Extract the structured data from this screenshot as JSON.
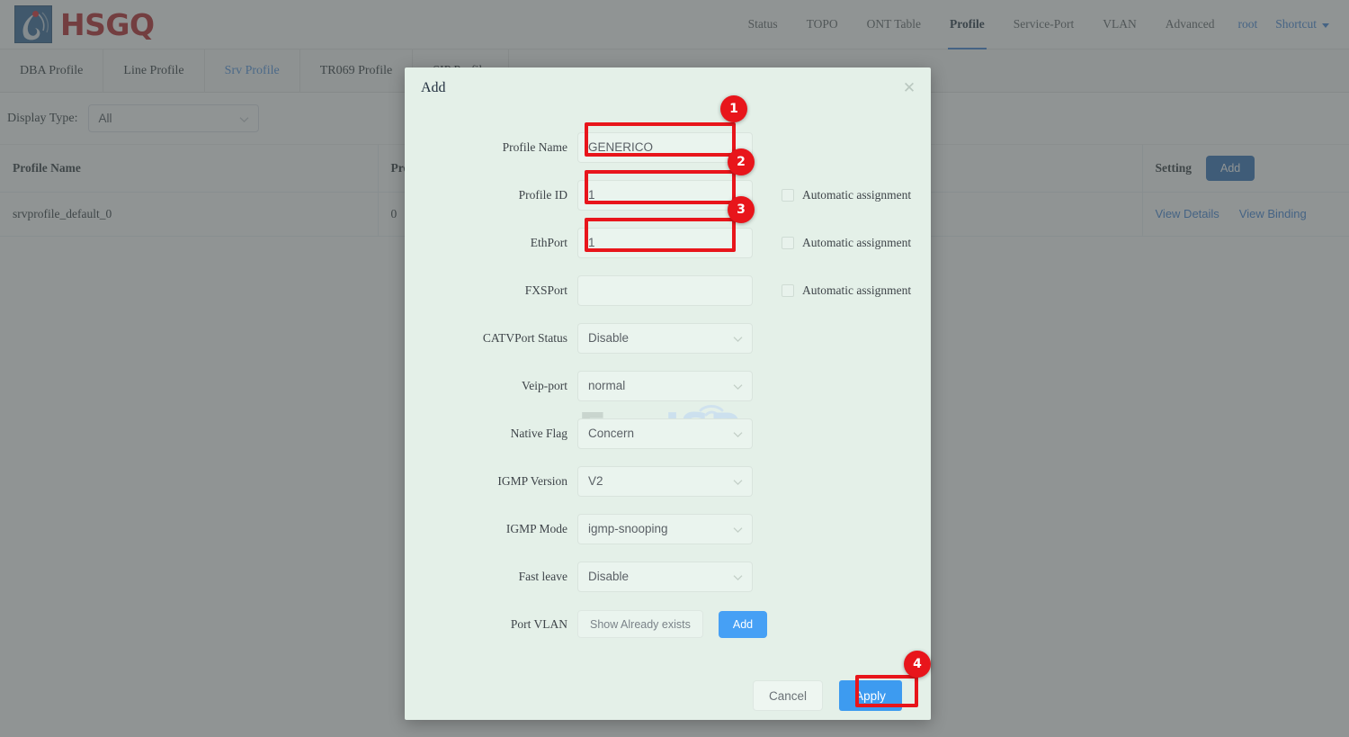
{
  "header": {
    "brand_name": "HSGQ",
    "logo_icon": "hsgq-droplet-logo",
    "nav": [
      {
        "label": "Status",
        "active": false
      },
      {
        "label": "TOPO",
        "active": false
      },
      {
        "label": "ONT Table",
        "active": false
      },
      {
        "label": "Profile",
        "active": true
      },
      {
        "label": "Service-Port",
        "active": false
      },
      {
        "label": "VLAN",
        "active": false
      },
      {
        "label": "Advanced",
        "active": false
      }
    ],
    "user_label": "root",
    "shortcut_label": "Shortcut"
  },
  "subtabs": [
    {
      "label": "DBA Profile",
      "active": false
    },
    {
      "label": "Line Profile",
      "active": false
    },
    {
      "label": "Srv Profile",
      "active": true
    },
    {
      "label": "TR069 Profile",
      "active": false
    },
    {
      "label": "SIP Profile",
      "active": false
    }
  ],
  "filter": {
    "label": "Display Type:",
    "value": "All"
  },
  "table": {
    "columns": [
      "Profile Name",
      "Profile ID",
      "Setting"
    ],
    "add_button": "Add",
    "rows": [
      {
        "profile_name": "srvprofile_default_0",
        "profile_id": "0",
        "actions": [
          "View Details",
          "View Binding"
        ]
      }
    ]
  },
  "modal": {
    "title": "Add",
    "close_icon": "close-icon",
    "watermark": "ForoISP",
    "watermark_part1": "Foro",
    "watermark_part2": "ISP",
    "fields": {
      "profile_name": {
        "label": "Profile Name",
        "value": "GENERICO"
      },
      "profile_id": {
        "label": "Profile ID",
        "value": "1",
        "checkbox_label": "Automatic assignment",
        "checked": false
      },
      "eth_port": {
        "label": "EthPort",
        "value": "1",
        "checkbox_label": "Automatic assignment",
        "checked": false
      },
      "fxs_port": {
        "label": "FXSPort",
        "value": "",
        "checkbox_label": "Automatic assignment",
        "checked": false
      },
      "catv_port_status": {
        "label": "CATVPort Status",
        "value": "Disable"
      },
      "veip_port": {
        "label": "Veip-port",
        "value": "normal"
      },
      "native_flag": {
        "label": "Native Flag",
        "value": "Concern"
      },
      "igmp_version": {
        "label": "IGMP Version",
        "value": "V2"
      },
      "igmp_mode": {
        "label": "IGMP Mode",
        "value": "igmp-snooping"
      },
      "fast_leave": {
        "label": "Fast leave",
        "value": "Disable"
      },
      "port_vlan": {
        "label": "Port VLAN",
        "show_button": "Show Already exists",
        "add_button": "Add"
      }
    },
    "footer": {
      "cancel": "Cancel",
      "apply": "Apply"
    }
  },
  "annotations": {
    "marker_color": "#e8151b",
    "steps": [
      {
        "number": "1",
        "target": "profile-name-input"
      },
      {
        "number": "2",
        "target": "profile-id-input"
      },
      {
        "number": "3",
        "target": "eth-port-input"
      },
      {
        "number": "4",
        "target": "apply-button"
      }
    ]
  }
}
